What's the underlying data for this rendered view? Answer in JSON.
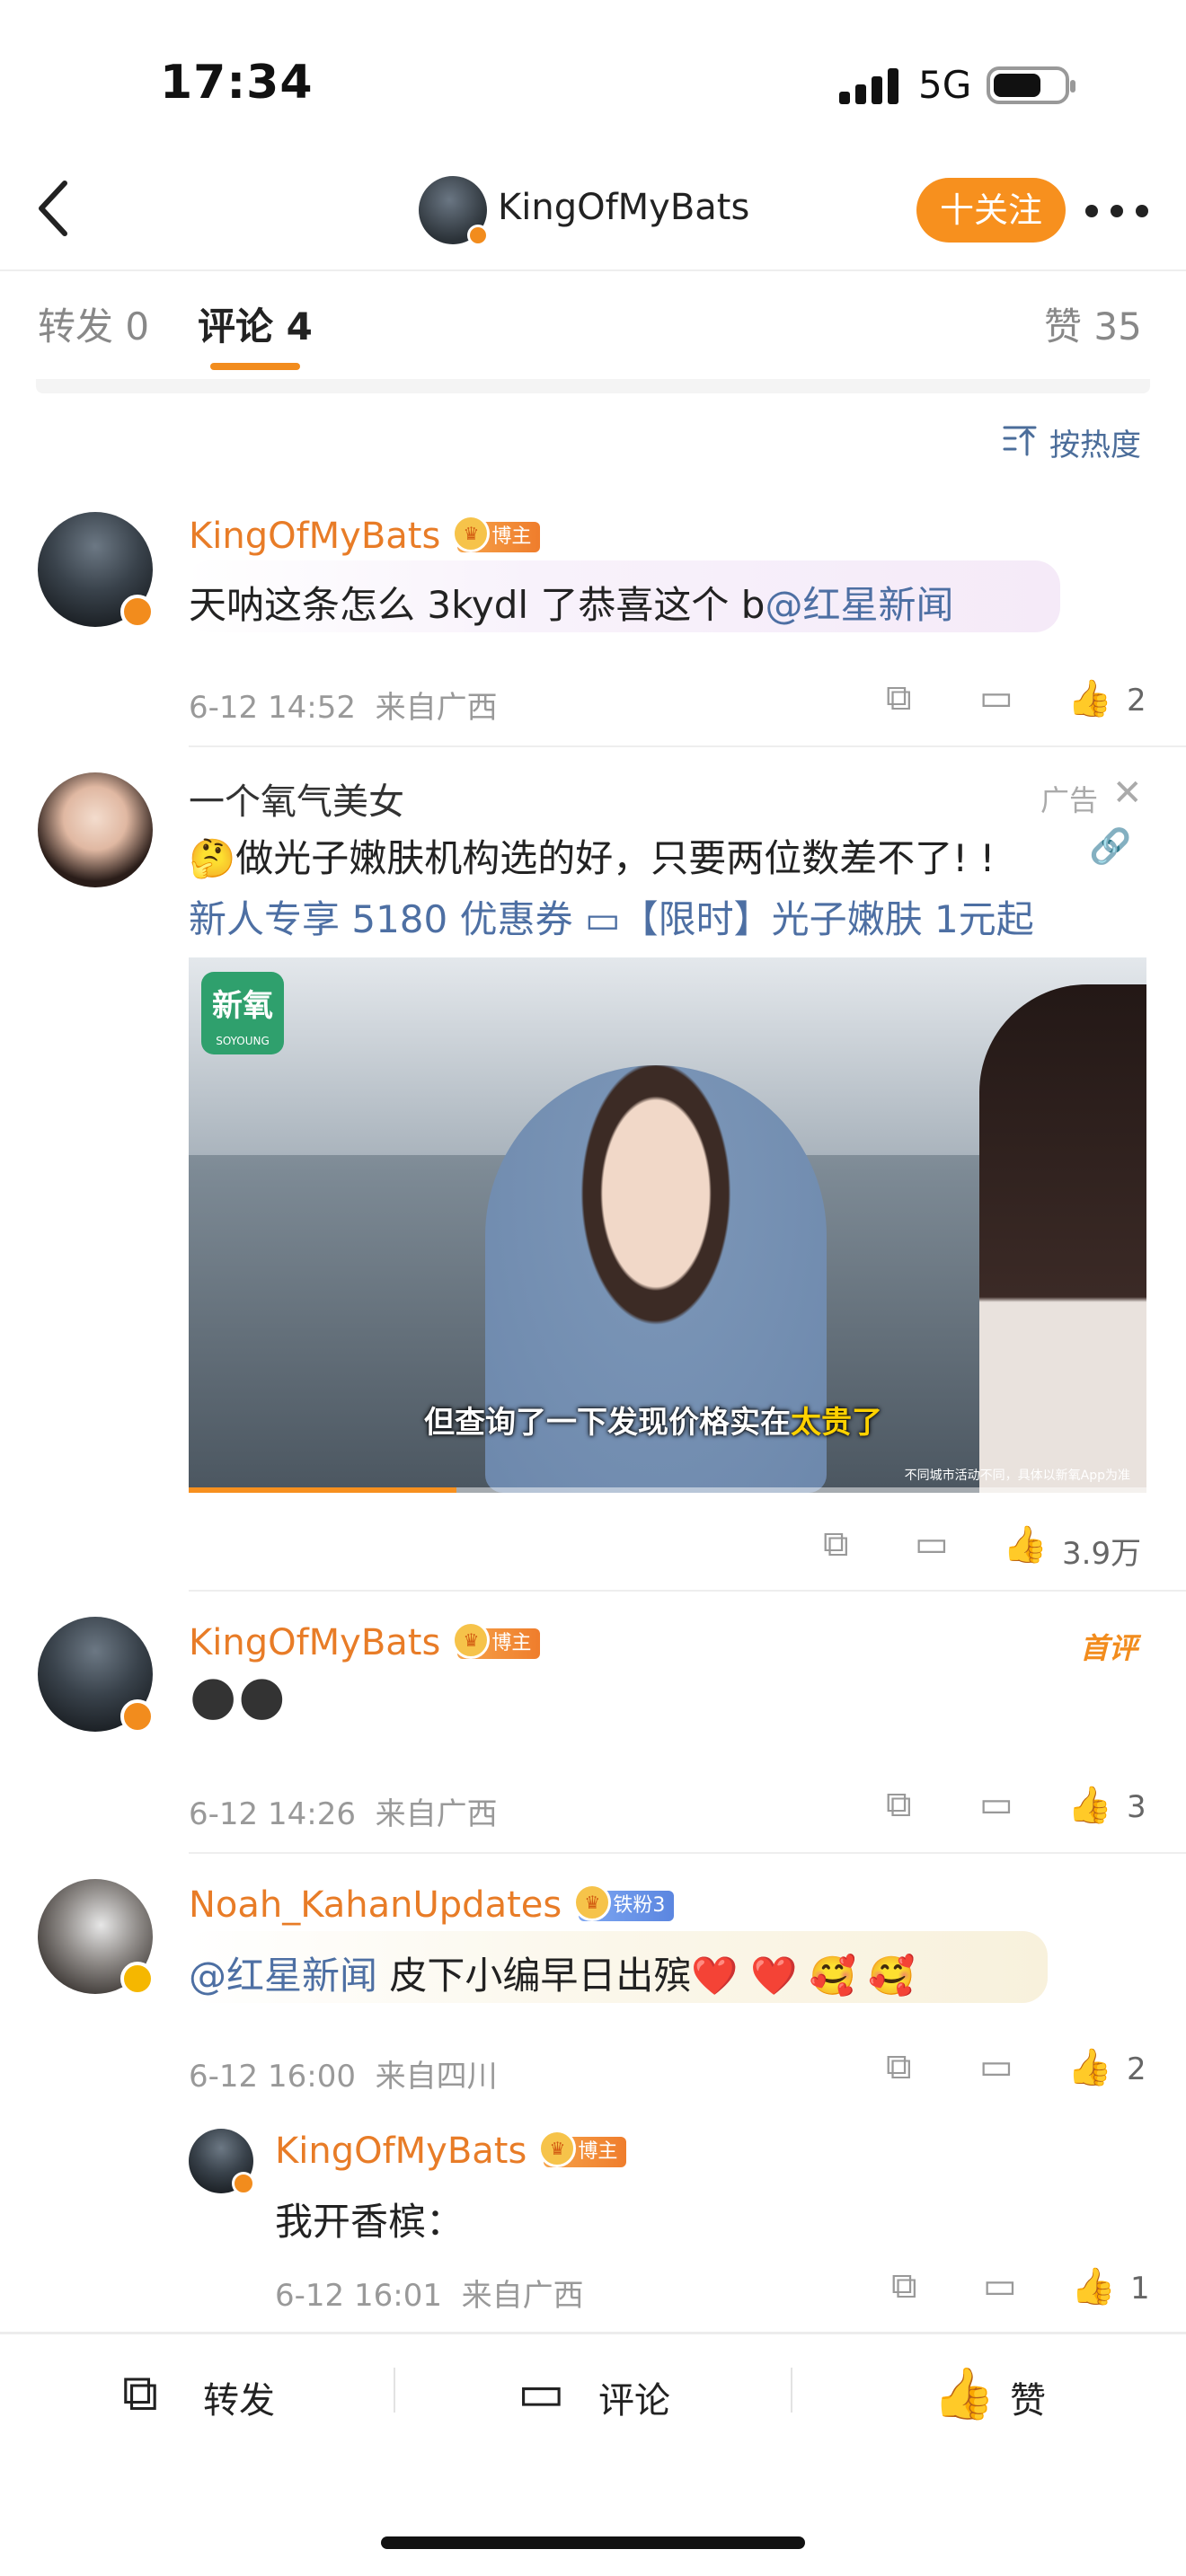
{
  "status_bar": {
    "time": "17:34",
    "network": "5G"
  },
  "header": {
    "username": "KingOfMyBats",
    "follow_label": "十关注"
  },
  "tabs": {
    "repost": "转发 0",
    "comment": "评论 4",
    "like": "赞 35"
  },
  "sort_label": "按热度",
  "comments": [
    {
      "user": "KingOfMyBats",
      "tag": "博主",
      "text": "天呐这条怎么 3kydl 了恭喜这个 b",
      "mention": "@红星新闻",
      "time": "6-12 14:52",
      "location": "来自广西",
      "likes": "2"
    },
    {
      "user": "KingOfMyBats",
      "tag": "博主",
      "first_badge": "首评",
      "emoji": "🌑🌑",
      "time": "6-12 14:26",
      "location": "来自广西",
      "likes": "3"
    },
    {
      "user": "Noah_KahanUpdates",
      "tag": "铁粉3",
      "mention": "@红星新闻",
      "text": " 皮下小编早日出殡❤️ ❤️ 🥰 🥰",
      "time": "6-12 16:00",
      "location": "来自四川",
      "likes": "2",
      "reply": {
        "user": "KingOfMyBats",
        "tag": "博主",
        "text": "我开香槟：",
        "time": "6-12 16:01",
        "location": "来自广西",
        "likes": "1"
      }
    }
  ],
  "ad": {
    "user": "一个氧气美女",
    "ad_label": "广告",
    "text": "🤔做光子嫩肤机构选的好，只要两位数差不了! !",
    "link_text": "新人专享 5180 优惠券 ▭【限时】光子嫩肤 1元起",
    "logo_text": "新氧",
    "logo_sub": "SOYOUNG",
    "subtitle_a": "但查询了一下发现价格实在",
    "subtitle_b": "太贵了",
    "fine_print": "不同城市活动不同，具体以新氧App为准",
    "likes": "3.9万"
  },
  "bottom_bar": {
    "repost": "转发",
    "comment": "评论",
    "like": "赞"
  },
  "colors": {
    "accent": "#f7901e",
    "mention": "#4d6fa3",
    "username": "#e87c27"
  }
}
